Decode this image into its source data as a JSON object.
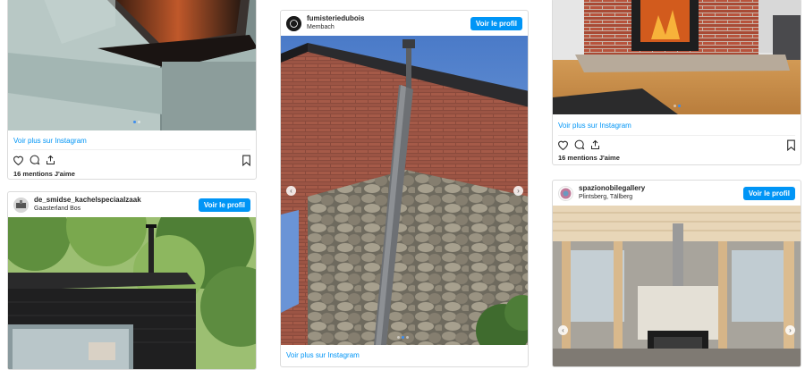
{
  "common": {
    "view_profile_label": "Voir le profil",
    "view_more_label": "Voir plus sur Instagram"
  },
  "posts": [
    {
      "username": "",
      "location": "",
      "likes": "16 mentions J'aime"
    },
    {
      "username": "de_smidse_kachelspeciaalzaak",
      "location": "Gaasterland Bos"
    },
    {
      "username": "fumisteriedubois",
      "location": "Membach"
    },
    {
      "username": "",
      "location": "",
      "likes": "16 mentions J'aime"
    },
    {
      "username": "spazionobilegallery",
      "location": "Plintsberg, Tällberg"
    }
  ],
  "colors": {
    "accent": "#0095f6",
    "border": "#dbdbdb",
    "text": "#262626"
  },
  "icons": [
    "heart-icon",
    "comment-icon",
    "share-icon",
    "bookmark-icon",
    "chevron-left-icon",
    "chevron-right-icon"
  ]
}
